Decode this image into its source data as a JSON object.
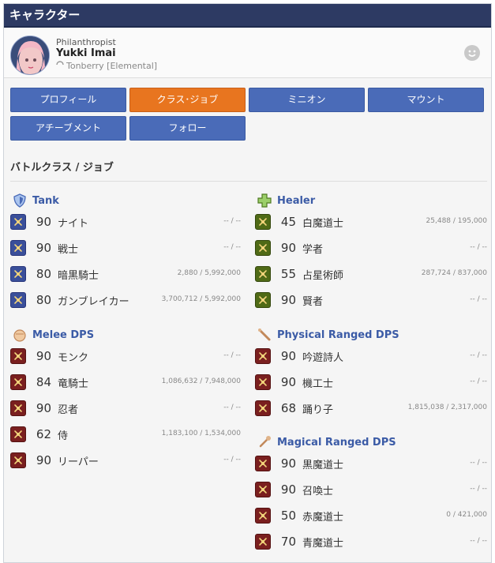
{
  "window": {
    "title": "キャラクター"
  },
  "profile": {
    "title": "Philanthropist",
    "name": "Yukki Imai",
    "world": "Tonberry [Elemental]"
  },
  "tabs": [
    {
      "label": "プロフィール",
      "active": false
    },
    {
      "label": "クラス･ジョブ",
      "active": true
    },
    {
      "label": "ミニオン",
      "active": false
    },
    {
      "label": "マウント",
      "active": false
    },
    {
      "label": "アチーブメント",
      "active": false
    },
    {
      "label": "フォロー",
      "active": false
    }
  ],
  "section": {
    "title": "バトルクラス / ジョブ"
  },
  "colors": {
    "header_bg": "#2d3a63",
    "tab_bg": "#4a6bb8",
    "tab_active": "#e8751f",
    "group_text": "#3b5ba6",
    "tank_icon": "#2a3f8f",
    "healer_icon": "#4f6a16",
    "dps_icon": "#7a1f1f"
  },
  "groups": {
    "tank": {
      "label": "Tank",
      "icon": "shield-icon",
      "jobs": [
        {
          "level": "90",
          "name": "ナイト",
          "exp": "-- / --"
        },
        {
          "level": "90",
          "name": "戦士",
          "exp": "-- / --"
        },
        {
          "level": "80",
          "name": "暗黒騎士",
          "exp": "2,880 / 5,992,000"
        },
        {
          "level": "80",
          "name": "ガンブレイカー",
          "exp": "3,700,712 / 5,992,000"
        }
      ]
    },
    "healer": {
      "label": "Healer",
      "icon": "cross-icon",
      "jobs": [
        {
          "level": "45",
          "name": "白魔道士",
          "exp": "25,488 / 195,000"
        },
        {
          "level": "90",
          "name": "学者",
          "exp": "-- / --"
        },
        {
          "level": "55",
          "name": "占星術師",
          "exp": "287,724 / 837,000"
        },
        {
          "level": "90",
          "name": "賢者",
          "exp": "-- / --"
        }
      ]
    },
    "melee": {
      "label": "Melee DPS",
      "icon": "fist-icon",
      "jobs": [
        {
          "level": "90",
          "name": "モンク",
          "exp": "-- / --"
        },
        {
          "level": "84",
          "name": "竜騎士",
          "exp": "1,086,632 / 7,948,000"
        },
        {
          "level": "90",
          "name": "忍者",
          "exp": "-- / --"
        },
        {
          "level": "62",
          "name": "侍",
          "exp": "1,183,100 / 1,534,000"
        },
        {
          "level": "90",
          "name": "リーパー",
          "exp": "-- / --"
        }
      ]
    },
    "ranged": {
      "label": "Physical Ranged DPS",
      "icon": "bow-icon",
      "jobs": [
        {
          "level": "90",
          "name": "吟遊詩人",
          "exp": "-- / --"
        },
        {
          "level": "90",
          "name": "機工士",
          "exp": "-- / --"
        },
        {
          "level": "68",
          "name": "踊り子",
          "exp": "1,815,038 / 2,317,000"
        }
      ]
    },
    "magical": {
      "label": "Magical Ranged DPS",
      "icon": "staff-icon",
      "jobs": [
        {
          "level": "90",
          "name": "黒魔道士",
          "exp": "-- / --"
        },
        {
          "level": "90",
          "name": "召喚士",
          "exp": "-- / --"
        },
        {
          "level": "50",
          "name": "赤魔道士",
          "exp": "0 / 421,000"
        },
        {
          "level": "70",
          "name": "青魔道士",
          "exp": "-- / --"
        }
      ]
    }
  }
}
